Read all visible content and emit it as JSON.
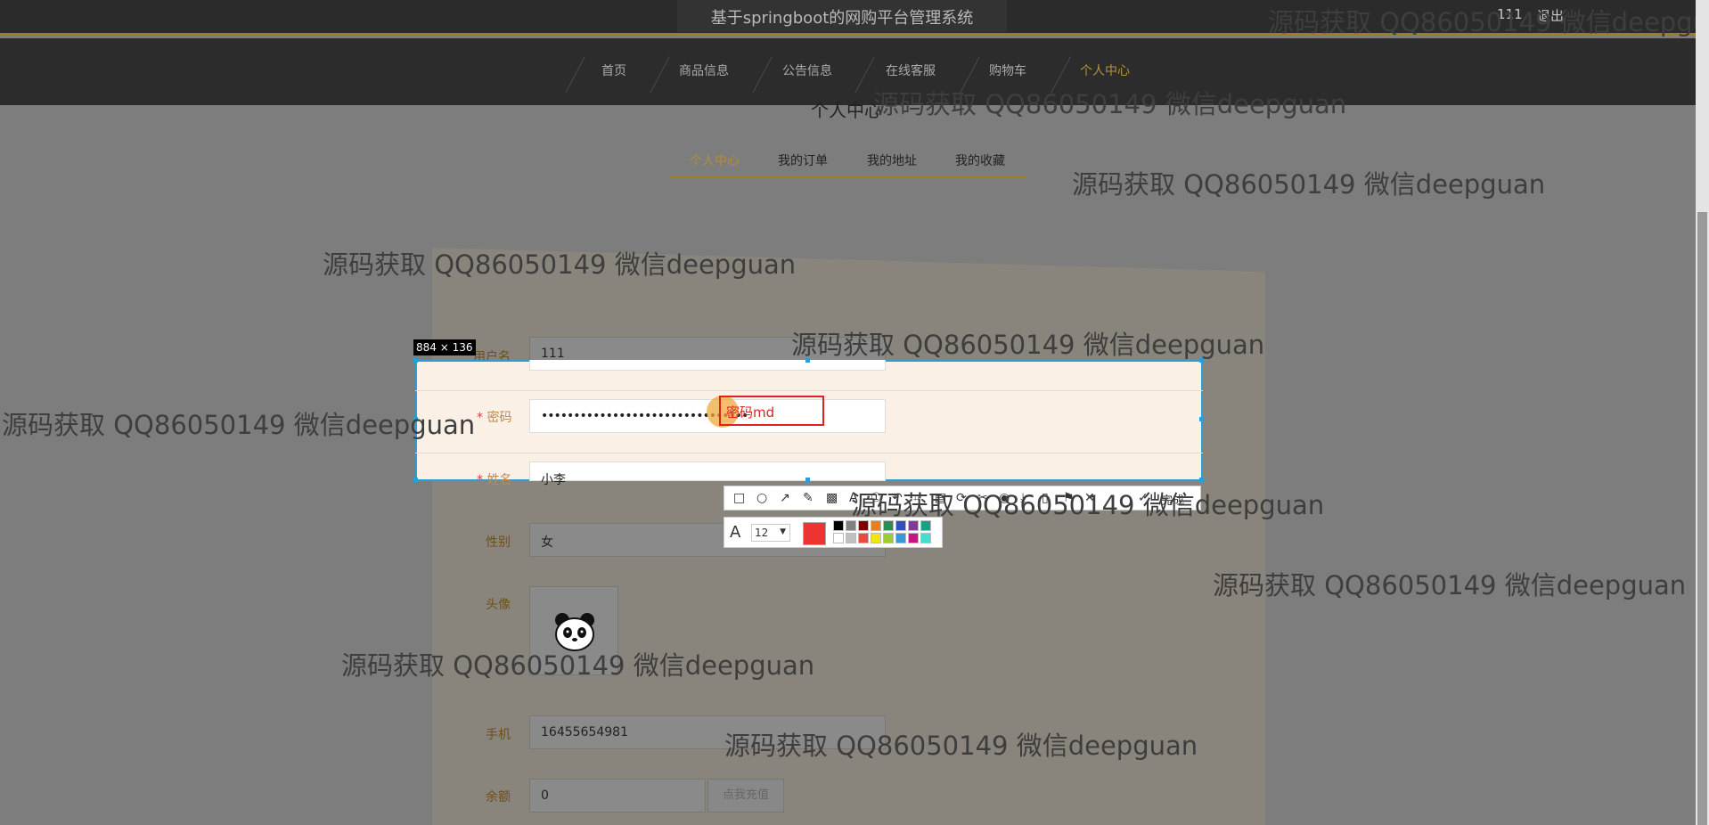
{
  "header": {
    "site_title": "基于springboot的网购平台管理系统",
    "user": "111",
    "logout": "退出"
  },
  "nav": {
    "items": [
      "首页",
      "商品信息",
      "公告信息",
      "在线客服",
      "购物车",
      "个人中心"
    ],
    "active": "个人中心"
  },
  "page_title": "个人中心",
  "tabs": [
    "个人中心",
    "我的订单",
    "我的地址",
    "我的收藏"
  ],
  "form": {
    "username_label": "用户名",
    "username": "111",
    "password_label": "密码",
    "password": "••••••••••••••••••••••••••••••••",
    "name_label": "姓名",
    "name": "小李",
    "gender_label": "性别",
    "gender": "女",
    "avatar_label": "头像",
    "phone_label": "手机",
    "phone": "16455654981",
    "balance_label": "余额",
    "balance": "0",
    "recharge": "点我充值"
  },
  "capture": {
    "size": "884 × 136",
    "annotation_text": "密码md",
    "font_size": "12",
    "done": "完成",
    "current_color": "#ee3333",
    "palette": [
      "#000000",
      "#808080",
      "#800000",
      "#e67e22",
      "#2e8b57",
      "#3050c0",
      "#7d3c98",
      "#16a085",
      "#ffffff",
      "#c0c0c0",
      "#e74c3c",
      "#f1e40f",
      "#9acd32",
      "#3498db",
      "#c71585",
      "#40e0d0"
    ]
  },
  "watermark": "源码获取 QQ86050149 微信deepguan"
}
